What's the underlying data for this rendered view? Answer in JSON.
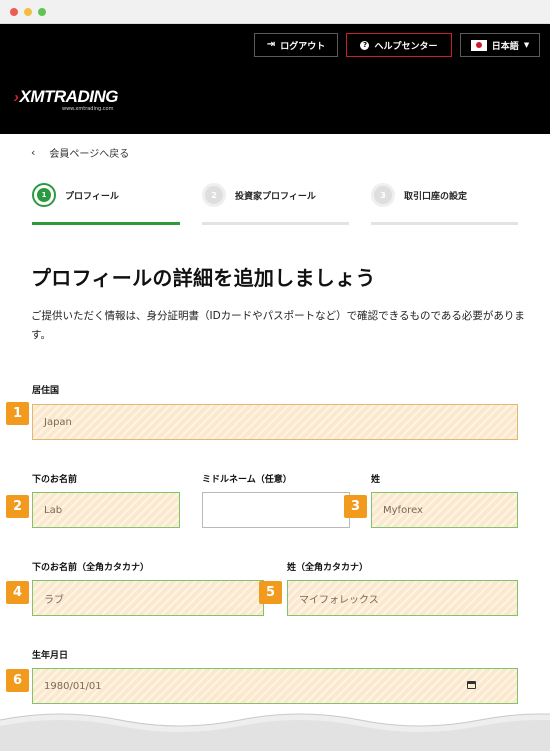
{
  "header": {
    "logout_label": "ログアウト",
    "help_label": "ヘルプセンター",
    "language_label": "日本語"
  },
  "brand": {
    "logo_text": "XMTRADING",
    "logo_sub": "www.xmtrading.com"
  },
  "nav": {
    "back_label": "会員ページへ戻る"
  },
  "steps": [
    {
      "number": "1",
      "label": "プロフィール",
      "active": true
    },
    {
      "number": "2",
      "label": "投資家プロフィール",
      "active": false
    },
    {
      "number": "3",
      "label": "取引口座の設定",
      "active": false
    }
  ],
  "page": {
    "title": "プロフィールの詳細を追加しましょう",
    "description": "ご提供いただく情報は、身分証明書（IDカードやパスポートなど）で確認できるものである必要があります。"
  },
  "form": {
    "country": {
      "label": "居住国",
      "value": "Japan",
      "badge": "1"
    },
    "first_name": {
      "label": "下のお名前",
      "value": "Lab",
      "badge": "2"
    },
    "middle_name": {
      "label": "ミドルネーム（任意）",
      "value": ""
    },
    "last_name": {
      "label": "姓",
      "value": "Myforex",
      "badge": "3"
    },
    "first_name_kana": {
      "label": "下のお名前（全角カタカナ）",
      "value": "ラブ",
      "badge": "4"
    },
    "last_name_kana": {
      "label": "姓（全角カタカナ）",
      "value": "マイフォレックス",
      "badge": "5"
    },
    "birth_date": {
      "label": "生年月日",
      "value": "1980/01/01",
      "badge": "6"
    }
  },
  "colors": {
    "accent_green": "#2b9a3e",
    "badge_orange": "#f29a1d",
    "help_border": "#c8202d",
    "header_bg": "#000000",
    "highlight_fill": "#fbe8cd"
  }
}
